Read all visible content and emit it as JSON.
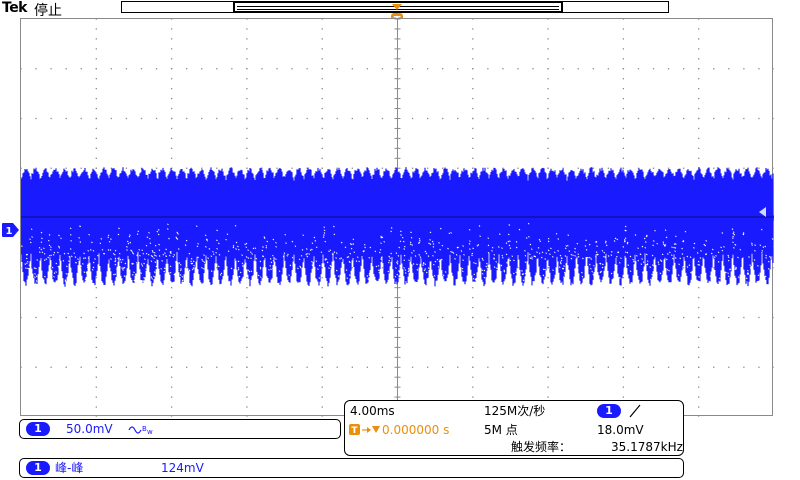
{
  "header": {
    "brand": "Tek",
    "run_state": "停止"
  },
  "trigger": {
    "marker_label": "T",
    "position_readout": "0.000000 s",
    "level_readout": "18.0mV",
    "frequency_label": "触发频率：",
    "frequency_value": "35.1787kHz",
    "slope_icon": "rising-edge-icon"
  },
  "channel1": {
    "marker_label": "1",
    "scale": "50.0mV",
    "bandwidth_icon": "bandwidth-limit-icon",
    "color": "#1a1aff"
  },
  "horizontal": {
    "time_per_div": "4.00ms",
    "sample_rate": "125M次/秒",
    "record_length": "5M 点"
  },
  "measurement": {
    "channel": "1",
    "name": "峰-峰",
    "value": "124mV"
  },
  "colors": {
    "trace": "#1a1aff",
    "trigger": "#e8900c",
    "grid": "#8a8a8a"
  }
}
